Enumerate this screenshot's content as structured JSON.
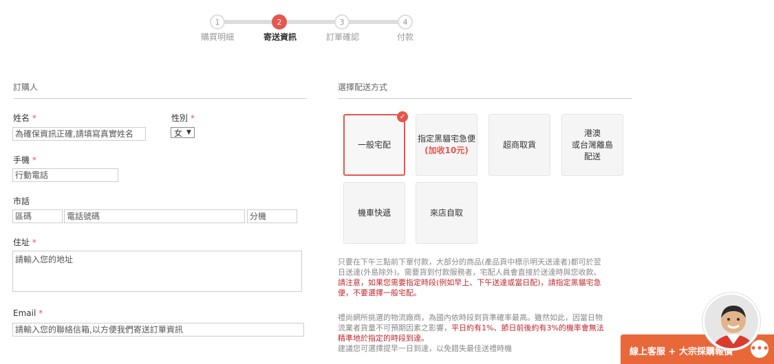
{
  "steps": [
    {
      "num": "1",
      "label": "購買明細"
    },
    {
      "num": "2",
      "label": "寄送資訊"
    },
    {
      "num": "3",
      "label": "訂單確認"
    },
    {
      "num": "4",
      "label": "付款"
    }
  ],
  "buyer": {
    "section_title": "訂購人",
    "name_label": "姓名",
    "name_placeholder": "為確保資訊正確,請填寫真實姓名",
    "gender_label": "性別",
    "gender_value": "女",
    "mobile_label": "手機",
    "mobile_placeholder": "行動電話",
    "phone_label": "市話",
    "area_code_placeholder": "區碼",
    "phone_number_placeholder": "電話號碼",
    "extension_placeholder": "分機",
    "address_label": "住址",
    "address_placeholder": "請輸入您的地址",
    "email_label": "Email",
    "email_placeholder": "請輸入您的聯絡信箱,以方便我們寄送訂單資訊",
    "required_mark": "*"
  },
  "delivery": {
    "section_title": "選擇配送方式",
    "options": [
      {
        "label": "一般宅配"
      },
      {
        "label": "指定黑貓宅急便",
        "sub": "(加收10元)"
      },
      {
        "label": "超商取貨"
      },
      {
        "label": "港澳",
        "label2": "或台灣離島",
        "label3": "配送"
      },
      {
        "label": "機車快遞"
      },
      {
        "label": "來店自取"
      }
    ],
    "selected_check": "✓",
    "note1_l1": "只要在下午三點前下單付款，大部分的商品(產品頁中標示明天送達者)都可於翌",
    "note1_l2": "日送達(外島除外)。需要貨到付款服務者，宅配人員會直接於送達時與您收款。",
    "note1_l3": "請注意，如果您需要指定時段(例如早上、下午送達或當日配)，請指定黑貓宅急",
    "note1_l4": "便，不要選擇一般宅配。",
    "note2_l1": "禮尚網所挑選的物流廠商，為國內依時段到貨準確率最高。雖然如此，因當日物",
    "note2_l2a": "流業者貨量不可預期因素之影響，",
    "note2_l2b": "平日約有1%、節日前後約有3%的機率會無法",
    "note2_l3": "精準地於指定的時段到達。",
    "note2_l4": "建議您可選擇提早一日到達，以免錯失最佳送禮時機"
  },
  "chat": {
    "label": "線上客服 + 大宗採購報價",
    "bubble": "•••"
  },
  "colors": {
    "accent": "#e8554e",
    "chat": "#e8683a",
    "warning_text": "#c0272d"
  }
}
